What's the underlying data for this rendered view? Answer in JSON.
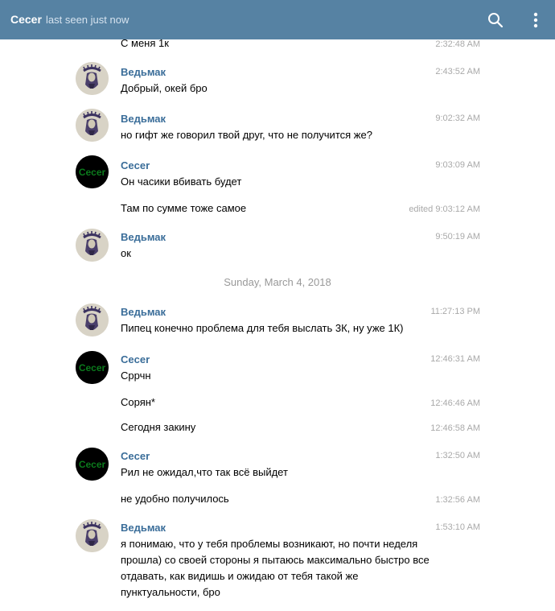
{
  "header": {
    "title": "Cecer",
    "status": "last seen just now",
    "search_icon": "search-icon",
    "menu_icon": "more-vertical-icon"
  },
  "colors": {
    "header_bg": "#5682a3",
    "author": "#3a6d99",
    "time": "#a9a9a9",
    "date": "#999999"
  },
  "avatars": {
    "cecer_text": "Cecer"
  },
  "messages": [
    {
      "text": "С меня 1к",
      "time": "2:32:48 AM"
    },
    {
      "author": "Ведьмак",
      "text": "Добрый, окей бро",
      "time": "2:43:52 AM"
    },
    {
      "author": "Ведьмак",
      "text": "но гифт же говорил твой друг, что не получится же?",
      "time": "9:02:32 AM"
    },
    {
      "author": "Cecer",
      "text": "Он часики вбивать будет",
      "time": "9:03:09 AM"
    },
    {
      "text": "Там по сумме тоже самое",
      "time": "edited 9:03:12 AM"
    },
    {
      "author": "Ведьмак",
      "text": "ок",
      "time": "9:50:19 AM"
    },
    {
      "date": "Sunday, March 4, 2018"
    },
    {
      "author": "Ведьмак",
      "text": "Пипец конечно проблема для тебя выслать 3К, ну уже 1К)",
      "time": "11:27:13 PM"
    },
    {
      "author": "Cecer",
      "text": "Сррчн",
      "time": "12:46:31 AM"
    },
    {
      "text": "Сорян*",
      "time": "12:46:46 AM"
    },
    {
      "text": "Сегодня закину",
      "time": "12:46:58 AM"
    },
    {
      "author": "Cecer",
      "text": "Рил не ожидал,что так всё выйдет",
      "time": "1:32:50 AM"
    },
    {
      "text": "не удобно получилось",
      "time": "1:32:56 AM"
    },
    {
      "author": "Ведьмак",
      "text": "я понимаю, что у тебя проблемы возникают, но почти неделя прошла) со своей стороны я пытаюсь максимально быстро все отдавать, как видишь и ожидаю от тебя такой же пунктуальности, бро",
      "time": "1:53:10 AM"
    }
  ]
}
